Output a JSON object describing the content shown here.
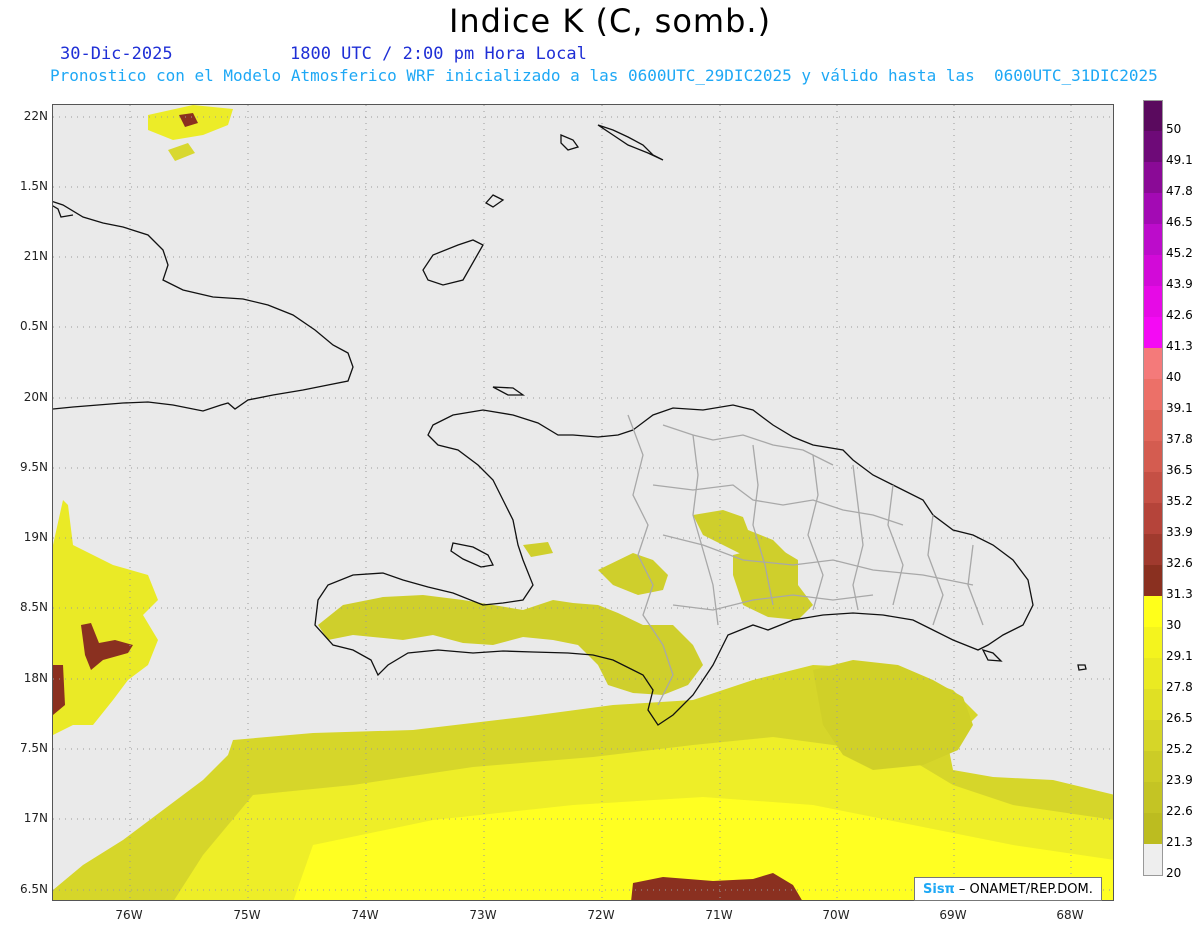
{
  "header": {
    "title": "Indice K (C, somb.)",
    "date": "30-Dic-2025",
    "time": "1800 UTC / 2:00 pm Hora Local",
    "subtitle": "Pronostico con el Modelo Atmosferico WRF inicializado a las 0600UTC_29DIC2025 y válido hasta las  0600UTC_31DIC2025"
  },
  "axes": {
    "lat_labels": [
      "22N",
      "1.5N",
      "21N",
      "0.5N",
      "20N",
      "9.5N",
      "19N",
      "8.5N",
      "18N",
      "7.5N",
      "17N",
      "6.5N"
    ],
    "lon_labels": [
      "76W",
      "75W",
      "74W",
      "73W",
      "72W",
      "71W",
      "70W",
      "69W",
      "68W"
    ]
  },
  "colorbar": {
    "labels": [
      "50",
      "49.1",
      "47.8",
      "46.5",
      "45.2",
      "43.9",
      "42.6",
      "41.3",
      "40",
      "39.1",
      "37.8",
      "36.5",
      "35.2",
      "33.9",
      "32.6",
      "31.3",
      "30",
      "29.1",
      "27.8",
      "26.5",
      "25.2",
      "23.9",
      "22.6",
      "21.3",
      "20"
    ],
    "colors": [
      "#5a0a5e",
      "#6e0a78",
      "#8a0a96",
      "#a30ab4",
      "#bc0ccb",
      "#d20ad8",
      "#e60ae6",
      "#f40af4",
      "#f47a7a",
      "#ec7068",
      "#e0665a",
      "#d45c50",
      "#c55045",
      "#b5443a",
      "#a03a2e",
      "#8a3020",
      "#ffff1a",
      "#f4f41e",
      "#eaea22",
      "#e0e024",
      "#d6d628",
      "#cccc26",
      "#c4c424",
      "#bcbc20",
      "#eeeeee"
    ]
  },
  "credit": {
    "brand": "Sisπ",
    "text": "– ONAMET/REP.DOM."
  },
  "colors": {
    "map_background": "#eaeaea",
    "grid": "#9a9a9a",
    "coast": "#111111",
    "borders": "#a8a8a8",
    "k_low": "#d8d830",
    "k_mid": "#eeee28",
    "k_high": "#ffff22",
    "k_30": "#8a3020"
  }
}
